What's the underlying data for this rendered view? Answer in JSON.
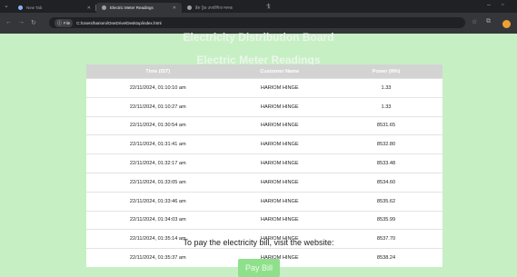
{
  "browser": {
    "tabs": [
      {
        "label": "New Tab",
        "active": false
      },
      {
        "label": "Electric Meter Readings",
        "active": true
      },
      {
        "label": "डैश ट्रैक उपयोगिता मानक",
        "active": false
      }
    ],
    "new_tab": "+",
    "address": {
      "chip": "File",
      "url": "C:/Users/hariomi/OneDrive/Desktop/index.html"
    }
  },
  "page": {
    "title": "Electricity Distribution Board",
    "table_title": "Electric Meter Readings",
    "columns": [
      "Time (IST)",
      "Customer Name",
      "Power (Wh)"
    ],
    "rows": [
      [
        "22/11/2024, 01:10:10 am",
        "HARIOM HINGE",
        "1.33"
      ],
      [
        "22/11/2024, 01:10:27 am",
        "HARIOM HINGE",
        "1.33"
      ],
      [
        "22/11/2024, 01:30:54 am",
        "HARIOM HINGE",
        "8531.65"
      ],
      [
        "22/11/2024, 01:31:41 am",
        "HARIOM HINGE",
        "8532.80"
      ],
      [
        "22/11/2024, 01:32:17 am",
        "HARIOM HINGE",
        "8533.48"
      ],
      [
        "22/11/2024, 01:33:05 am",
        "HARIOM HINGE",
        "8534.60"
      ],
      [
        "22/11/2024, 01:33:46 am",
        "HARIOM HINGE",
        "8535.62"
      ],
      [
        "22/11/2024, 01:34:03 am",
        "HARIOM HINGE",
        "8535.99"
      ],
      [
        "22/11/2024, 01:35:14 am",
        "HARIOM HINGE",
        "8537.70"
      ],
      [
        "22/11/2024, 01:35:37 am",
        "HARIOM HINGE",
        "8538.24"
      ]
    ],
    "visit_text": "To pay the electricity bill, visit the website:",
    "pay_button": "Pay Bill"
  },
  "colors": {
    "page_bg": "#c6f0c4",
    "header_bg": "#d3d3d3",
    "button_bg": "#8fe08a"
  }
}
